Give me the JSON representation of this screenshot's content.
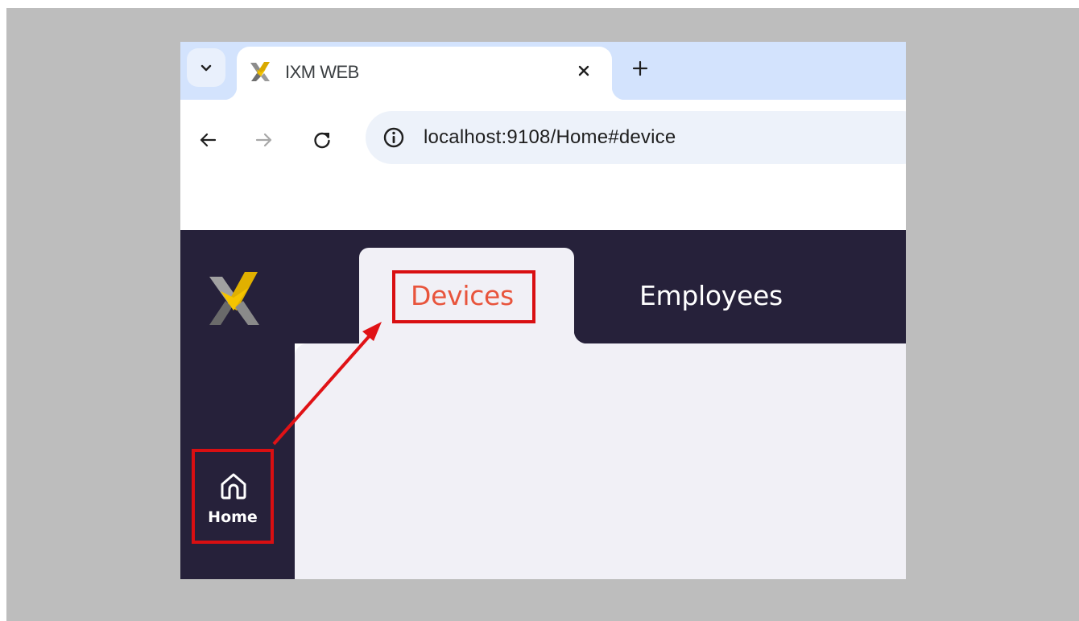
{
  "browser": {
    "tab": {
      "title": "IXM WEB",
      "favicon": "ixm-logo-icon"
    },
    "url": "localhost:9108/Home#device",
    "icons": {
      "tab_search": "chevron-down-icon",
      "close": "close-icon",
      "new_tab": "plus-icon",
      "back": "back-arrow-icon",
      "forward": "forward-arrow-icon",
      "reload": "reload-icon",
      "site_info": "info-icon"
    }
  },
  "app": {
    "tabs": [
      {
        "label": "Devices",
        "active": true
      },
      {
        "label": "Employees",
        "active": false
      }
    ],
    "sidebar": {
      "items": [
        {
          "label": "Home",
          "icon": "home-icon"
        }
      ]
    }
  },
  "colors": {
    "app_bar": "#26213a",
    "content_bg": "#f1f0f6",
    "active_tab_text": "#e8543c",
    "annotation": "#d90f12",
    "logo_gold": "#e6b800"
  }
}
